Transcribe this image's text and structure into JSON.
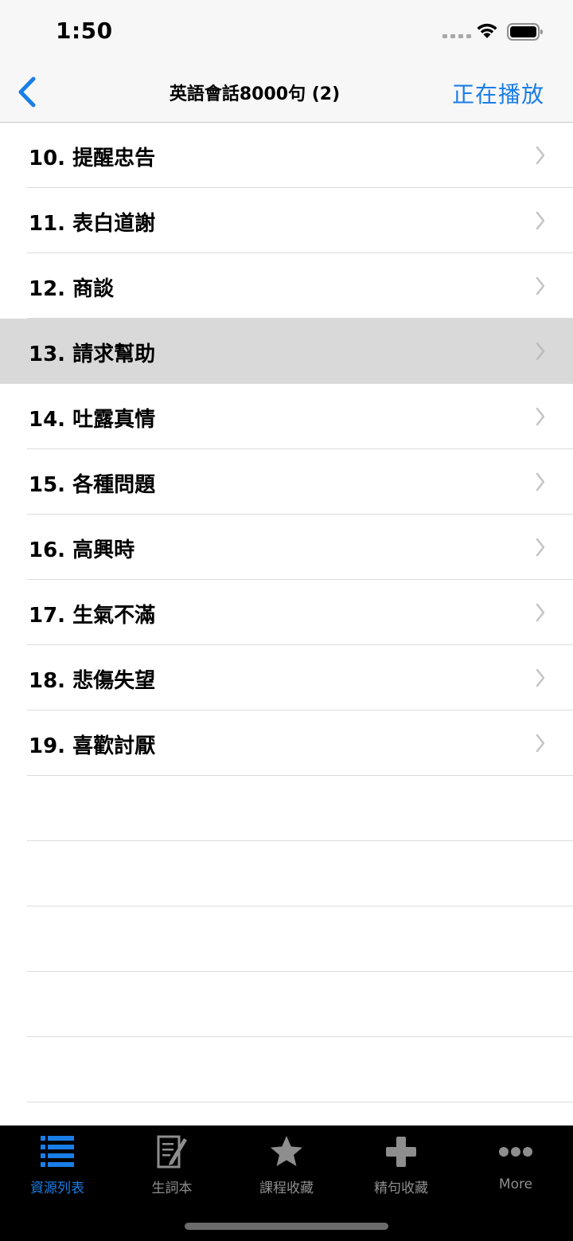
{
  "status_bar": {
    "time": "1:50"
  },
  "nav": {
    "title": "英語會話8000句 (2)",
    "action_label": "正在播放",
    "accent_color": "#1a7ee8"
  },
  "list": {
    "items": [
      {
        "label": "10. 提醒忠告",
        "selected": false
      },
      {
        "label": "11. 表白道謝",
        "selected": false
      },
      {
        "label": "12. 商談",
        "selected": false
      },
      {
        "label": "13. 請求幫助",
        "selected": true
      },
      {
        "label": "14. 吐露真情",
        "selected": false
      },
      {
        "label": "15. 各種問題",
        "selected": false
      },
      {
        "label": "16. 高興時",
        "selected": false
      },
      {
        "label": "17. 生氣不滿",
        "selected": false
      },
      {
        "label": "18. 悲傷失望",
        "selected": false
      },
      {
        "label": "19. 喜歡討厭",
        "selected": false
      }
    ]
  },
  "tab_bar": {
    "tabs": [
      {
        "label": "資源列表",
        "icon": "list-icon",
        "active": true
      },
      {
        "label": "生詞本",
        "icon": "notebook-pen-icon",
        "active": false
      },
      {
        "label": "課程收藏",
        "icon": "star-icon",
        "active": false
      },
      {
        "label": "精句收藏",
        "icon": "plus-icon",
        "active": false
      },
      {
        "label": "More",
        "icon": "more-dots-icon",
        "active": false
      }
    ]
  }
}
